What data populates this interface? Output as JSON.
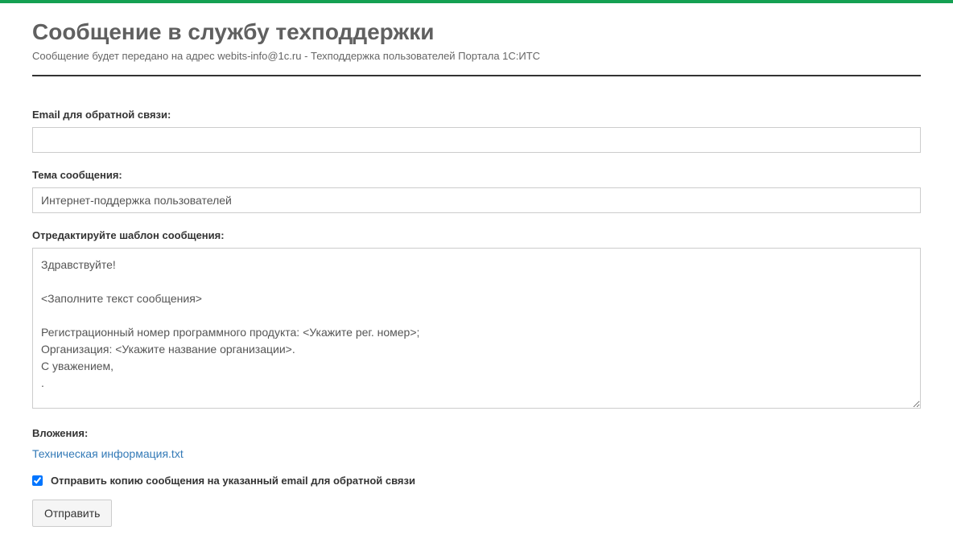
{
  "header": {
    "title": "Сообщение в службу техподдержки",
    "subtitle": "Сообщение будет передано на адрес webits-info@1c.ru - Техподдержка пользователей Портала 1С:ИТС"
  },
  "form": {
    "email": {
      "label": "Email для обратной связи:",
      "value": ""
    },
    "subject": {
      "label": "Тема сообщения:",
      "value": "Интернет-поддержка пользователей"
    },
    "message": {
      "label": "Отредактируйте шаблон сообщения:",
      "value": "Здравствуйте!\n\n<Заполните текст сообщения>\n\nРегистрационный номер программного продукта: <Укажите рег. номер>;\nОрганизация: <Укажите название организации>.\nС уважением,\n."
    },
    "attachments": {
      "label": "Вложения:",
      "file": "Техническая информация.txt"
    },
    "copy_checkbox": {
      "label": "Отправить копию сообщения на указанный email для обратной связи",
      "checked": true
    },
    "submit_label": "Отправить"
  }
}
